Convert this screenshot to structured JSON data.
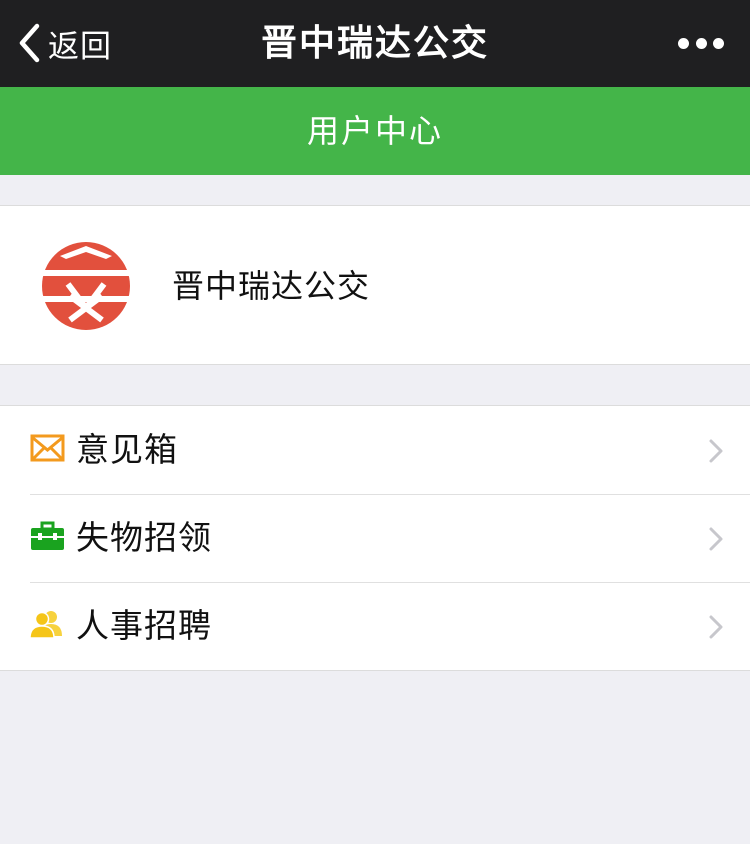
{
  "nav": {
    "back_label": "返回",
    "title": "晋中瑞达公交",
    "more_icon": "more-dots-icon"
  },
  "header": {
    "title": "用户中心"
  },
  "profile": {
    "name": "晋中瑞达公交",
    "logo_icon": "bus-company-logo"
  },
  "menu": {
    "items": [
      {
        "label": "意见箱",
        "icon": "mail-envelope-icon",
        "icon_color": "#f39a1e"
      },
      {
        "label": "失物招领",
        "icon": "briefcase-icon",
        "icon_color": "#1aa31f"
      },
      {
        "label": "人事招聘",
        "icon": "people-icon",
        "icon_color": "#f5c518"
      }
    ]
  },
  "colors": {
    "nav_background": "#1f1f21",
    "header_background": "#44b549",
    "page_background": "#efeff4",
    "logo_red": "#e2503d",
    "chevron": "#c7c7cc"
  }
}
